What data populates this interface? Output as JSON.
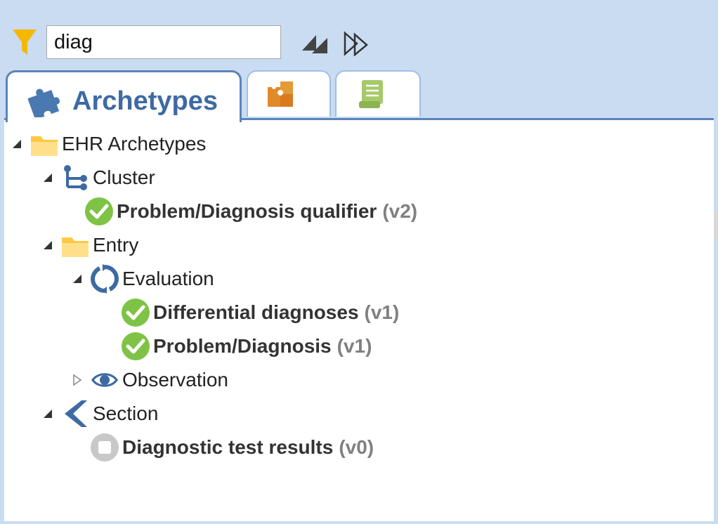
{
  "search": {
    "value": "diag",
    "placeholder": ""
  },
  "toolbar": {
    "filter_icon": "filter-icon",
    "expand_icon": "expand-all-icon",
    "next_icon": "next-match-icon"
  },
  "tabs": [
    {
      "label": "Archetypes",
      "icon": "puzzle-piece-icon",
      "active": true
    },
    {
      "label": "",
      "icon": "template-puzzle-icon",
      "active": false
    },
    {
      "label": "",
      "icon": "document-scroll-icon",
      "active": false
    }
  ],
  "tree": {
    "root": {
      "label": "EHR Archetypes",
      "icon": "folder-icon"
    },
    "cluster": {
      "label": "Cluster",
      "icon": "cluster-icon"
    },
    "cluster_items": [
      {
        "label": "Problem/Diagnosis qualifier",
        "version": "(v2)",
        "status": "published-check-icon"
      }
    ],
    "entry": {
      "label": "Entry",
      "icon": "folder-icon"
    },
    "evaluation": {
      "label": "Evaluation",
      "icon": "evaluation-cycle-icon"
    },
    "evaluation_items": [
      {
        "label": "Differential diagnoses",
        "version": "(v1)",
        "status": "published-check-icon"
      },
      {
        "label": "Problem/Diagnosis",
        "version": "(v1)",
        "status": "published-check-icon"
      }
    ],
    "observation": {
      "label": "Observation",
      "icon": "eye-icon",
      "collapsed": true
    },
    "section": {
      "label": "Section",
      "icon": "section-chevron-icon"
    },
    "section_items": [
      {
        "label": "Diagnostic test results",
        "version": "(v0)",
        "status": "draft-icon"
      }
    ]
  },
  "colors": {
    "background": "#c9dcf2",
    "accent": "#3d6aa3",
    "check_green": "#7ec346",
    "folder": "#ffd56a"
  }
}
